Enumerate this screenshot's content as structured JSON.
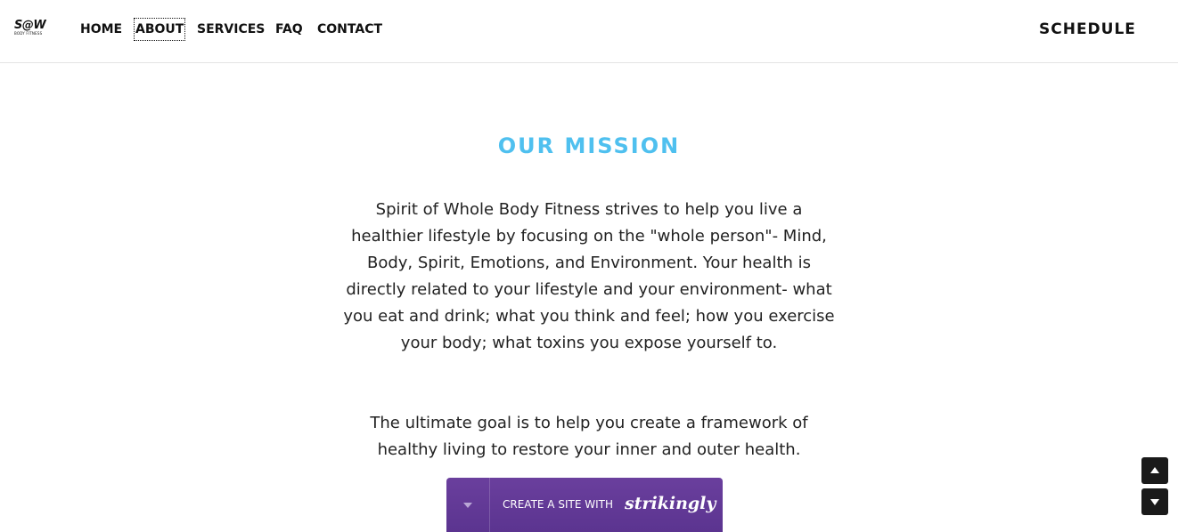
{
  "header": {
    "logo": {
      "mark": "S@W",
      "sub": "BODY FITNESS"
    },
    "nav": [
      {
        "label": "HOME"
      },
      {
        "label": "ABOUT",
        "active": true
      },
      {
        "label": "SERVICES"
      },
      {
        "label": "FAQ"
      },
      {
        "label": "CONTACT"
      }
    ],
    "schedule_label": "SCHEDULE"
  },
  "mission": {
    "title": "OUR MISSION",
    "paragraph1": "Spirit of Whole Body Fitness strives to help you live a healthier lifestyle by focusing on the \"whole person\"- Mind, Body, Spirit, Emotions, and Environment. Your health is directly related to your lifestyle and your environment- what you eat and drink; what you think and feel; how you exercise your body; what toxins you expose yourself to.",
    "paragraph2": "The ultimate goal is to help you create a framework of healthy living to restore your inner and outer health."
  },
  "strikingly": {
    "cta_text": "CREATE A SITE WITH",
    "brand": "strikingly"
  },
  "scroll_controls": {
    "up_icon": "arrow-up-icon",
    "down_icon": "arrow-down-icon"
  },
  "colors": {
    "accent": "#4fc0ef",
    "banner": "#5b3490",
    "text": "#222222"
  }
}
